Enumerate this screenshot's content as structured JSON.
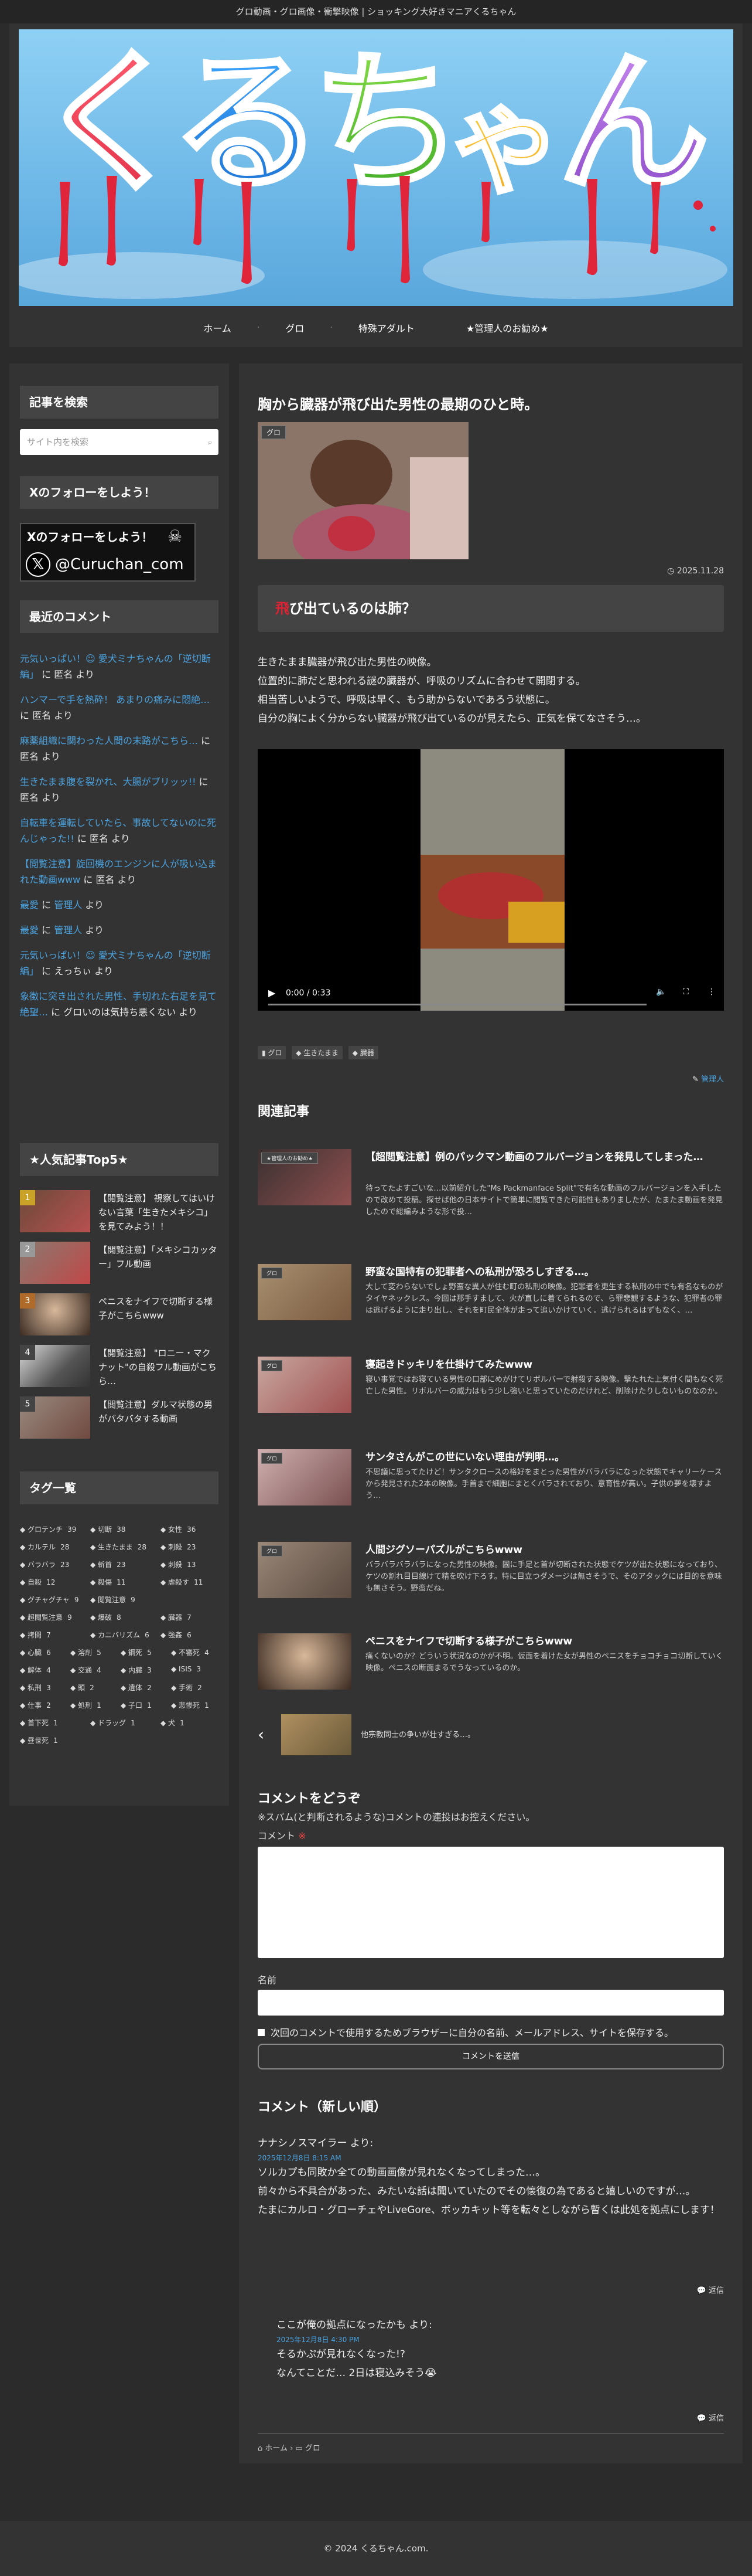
{
  "site": {
    "tagline": "グロ動画・グロ画像・衝撃映像 | ショッキング大好きマニアくるちゃん",
    "logo_text": "くるちゃん",
    "footer": "© 2024 くるちゃん.com."
  },
  "nav": [
    "ホーム",
    "グロ",
    "特殊アダルト",
    "★管理人のお勧め★"
  ],
  "sidebar": {
    "search_title": "記事を検索",
    "search_placeholder": "サイト内を検索",
    "follow_title": "Xのフォローをしよう！",
    "x_banner_top": "Xのフォローをしよう！",
    "x_banner_handle": "@Curuchan_com",
    "recent_title": "最近のコメント",
    "recent": [
      {
        "link": "元気いっぱい！☺ 愛犬ミナちゃんの「逆切断編」",
        "by": "に 匿名 より"
      },
      {
        "link": "ハンマーで手を熱砕！ あまりの痛みに悶絶…",
        "by": "に 匿名 より"
      },
      {
        "link": "麻薬組織に関わった人間の末路がこちら…",
        "by": "に 匿名 より"
      },
      {
        "link": "生きたまま腹を裂かれ、大腸がブリッッ!!",
        "by": "に 匿名 より"
      },
      {
        "link": "自転車を運転していたら、事故してないのに死んじゃった!!",
        "by": "に 匿名 より"
      },
      {
        "link": "【閲覧注意】旋回機のエンジンに人が吸い込まれた動画www",
        "by": "に 匿名 より"
      },
      {
        "link": "最愛",
        "mid": "に",
        "link2": "管理人",
        "by": "より"
      },
      {
        "link": "最愛",
        "mid": "に",
        "link2": "管理人",
        "by": "より"
      },
      {
        "link": "元気いっぱい！☺ 愛犬ミナちゃんの「逆切断編」",
        "by": "に えっちぃ より"
      },
      {
        "link": "象徴に突き出された男性、手切れた右足を見て絶望…",
        "by": "に グロいのは気持ち悪くない より"
      }
    ],
    "top5_title": "★人気記事Top5★",
    "top5": [
      {
        "rank": "1",
        "text": "【閲覧注意】 視察してはいけない言葉「生きたメキシコ」を見てみよう！！"
      },
      {
        "rank": "2",
        "text": "【閲覧注意】「メキシコカッター」フル動画"
      },
      {
        "rank": "3",
        "text": "ペニスをナイフで切断する様子がこちらwww"
      },
      {
        "rank": "4",
        "text": "【閲覧注意】 \"ロニー・マクナット\"の自殺フル動画がこちら…"
      },
      {
        "rank": "5",
        "text": "【閲覧注意】ダルマ状態の男がバタバタする動画"
      }
    ],
    "tags_title": "タグ一覧",
    "tags": [
      [
        [
          "グロテンチ",
          "39"
        ],
        [
          "切断",
          "38"
        ],
        [
          "女性",
          "36"
        ]
      ],
      [
        [
          "カルテル",
          "28"
        ],
        [
          "生きたまま",
          "28"
        ],
        [
          "刺殺",
          "23"
        ]
      ],
      [
        [
          "バラバラ",
          "23"
        ],
        [
          "斬首",
          "23"
        ],
        [
          "刺殺",
          "13"
        ]
      ],
      [
        [
          "自殺",
          "12"
        ],
        [
          "殺傷",
          "11"
        ],
        [
          "虐殺す",
          "11"
        ]
      ],
      [
        [
          "グチャグチャ",
          "9"
        ],
        [
          "閲覧注意",
          "9"
        ]
      ],
      [
        [
          "超閲覧注意",
          "9"
        ],
        [
          "爆破",
          "8"
        ],
        [
          "臓器",
          "7"
        ]
      ],
      [
        [
          "拷問",
          "7"
        ],
        [
          "カニバリズム",
          "6"
        ],
        [
          "強姦",
          "6"
        ]
      ],
      [
        [
          "心臓",
          "6"
        ],
        [
          "溶剤",
          "5"
        ],
        [
          "鋼死",
          "5"
        ],
        [
          "不審死",
          "4"
        ]
      ],
      [
        [
          "解体",
          "4"
        ],
        [
          "交通",
          "4"
        ],
        [
          "内臓",
          "3"
        ],
        [
          "ISIS",
          "3"
        ]
      ],
      [
        [
          "私刑",
          "3"
        ],
        [
          "頭",
          "2"
        ],
        [
          "遺体",
          "2"
        ],
        [
          "手術",
          "2"
        ]
      ],
      [
        [
          "仕事",
          "2"
        ],
        [
          "処刑",
          "1"
        ],
        [
          "子口",
          "1"
        ],
        [
          "悲惨死",
          "1"
        ]
      ],
      [
        [
          "首下死",
          "1"
        ],
        [
          "ドラッグ",
          "1"
        ],
        [
          "犬",
          "1"
        ]
      ],
      [
        [
          "昼世死",
          "1"
        ]
      ]
    ]
  },
  "post": {
    "title": "胸から臓器が飛び出た男性の最期のひと時。",
    "badge": "グロ",
    "date": "2025.11.28",
    "heading_red": "飛",
    "heading_rest": "び出ているのは肺？",
    "body": [
      "生きたまま臓器が飛び出た男性の映像。",
      "位置的に肺だと思われる謎の臓器が、呼吸のリズムに合わせて開閉する。",
      "相当苦しいようで、呼吸は早く、もう助からないであろう状態に。",
      "自分の胸によく分からない臓器が飛び出ているのが見えたら、正気を保てなさそう…。"
    ],
    "video_time": "0:00 / 0:33",
    "categories": [
      "グロ",
      "生きたまま",
      "臓器"
    ],
    "author": "管理人"
  },
  "related": {
    "title": "関連記事",
    "items": [
      {
        "title": "【超閲覧注意】例のパックマン動画のフルバージョンを発見してしまった…",
        "desc": "待ってたよすごいな…以前紹介した\"Ms Packmanface Split\"で有名な動画のフルバージョンを入手したので改めて投稿。探せば他の日本サイトで簡単に閲覧できた可能性もありましたが、たまたま動画を発見したので総編みような形で投…",
        "badge": "★管理人のお勧め★"
      },
      {
        "title": "野蛮な国特有の犯罪者への私刑が恐ろしすぎる…。",
        "desc": "大して変わらないでしょ野蛮な異人が住む町の私刑の映像。犯罪者を更生する私刑の中でも有名なものがタイヤネックレス。今回は那手すまして、火が直しに着てられるので、ら罪悲観するような、犯罪者の罪は逃げるように走り出し、それを町民全体が走って追いかけていく。逃げられるはずもなく、…",
        "badge": "グロ"
      },
      {
        "title": "寝起きドッキリを仕掛けてみたwww",
        "desc": "寝い事覚ではお寝ている男性の口部にめがけてリボルバーで射殺する映像。撃たれた上気付く間もなく死亡した男性。リボルバーの威力はもう少し強いと思っていたのだけれど、削除けたりしないものなのか。",
        "badge": "グロ"
      },
      {
        "title": "サンタさんがこの世にいない理由が判明…。",
        "desc": "不思議に思ってたけど！サンタクロースの格好をまとった男性がバラバラになった状態でキャリーケースから発見された2本の映像。手首まで細胞にまとくバラされており、意育性が高い。子供の夢を壊すよう…",
        "badge": "グロ"
      },
      {
        "title": "人間ジグソーパズルがこちらwww",
        "desc": "バラバラバラバラになった男性の映像。固に手足と首が切断された状態でケツが出た状態になっており、ケツの割れ目目線けて精を吹け下ろす。特に目立つダメージは無さそうで、そのアタックには目的を意味も無さそう。野蛮だね。",
        "badge": "グロ"
      },
      {
        "title": "ペニスをナイフで切断する様子がこちらwww",
        "desc": "痛くないのか？どういう状況なのかが不明。仮面を着けた女が男性のペニスをチョコチョコ切断していく映像。ペニスの断面まるでうなっているのか。",
        "badge": ""
      }
    ],
    "prev_text": "他宗教同士の争いが壮すぎる…。"
  },
  "comment_form": {
    "title": "コメントをどうぞ",
    "note": "※スパム(と判断されるような)コメントの連投はお控えください。",
    "comment_label": "コメント",
    "required_mark": "※",
    "name_label": "名前",
    "checkbox_label": "次回のコメントで使用するためブラウザーに自分の名前、メールアドレス、サイトを保存する。",
    "submit_label": "コメントを送信"
  },
  "comments": {
    "title": "コメント（新しい順）",
    "items": [
      {
        "author": "ナナシノスマイラー より:",
        "date": "2025年12月8日 8:15 AM",
        "lines": [
          "ソルカプも同敗か全ての動画画像が見れなくなってしまった…。",
          "前々から不具合があった、みたいな話は聞いていたのでその懐復の為であると嬉しいのですが…。",
          "たまにカルロ・グローチェやLiveGore、ボッカキット等を転々としながら暫くは此処を拠点にします！"
        ],
        "reply": "返信"
      },
      {
        "author": "ここが俺の拠点になったかも より:",
        "date": "2025年12月8日 4:30 PM",
        "lines": [
          "そるかぷが見れなくなった!?",
          "なんてことだ… 2日は寝込みそう😭"
        ],
        "reply": "返信"
      }
    ]
  },
  "breadcrumb": [
    "ホーム",
    "グロ"
  ]
}
